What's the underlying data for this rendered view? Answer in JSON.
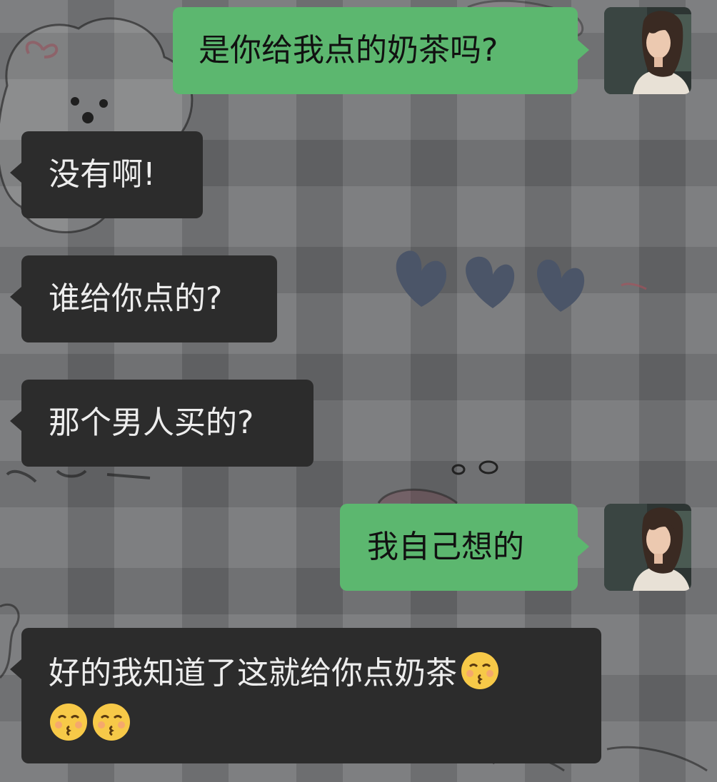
{
  "messages": [
    {
      "direction": "out",
      "text": "是你给我点的奶茶吗?",
      "sender": "me"
    },
    {
      "direction": "in",
      "text": "没有啊!"
    },
    {
      "direction": "in",
      "text": "谁给你点的?"
    },
    {
      "direction": "in",
      "text": "那个男人买的?"
    },
    {
      "direction": "out",
      "text": "我自己想的",
      "sender": "me"
    },
    {
      "direction": "in",
      "line1": "好的我知道了这就给你点奶茶",
      "emoji_icon": "kissing-face-with-smiling-eyes-icon"
    }
  ],
  "colors": {
    "outgoing_bubble": "#5cb76f",
    "incoming_bubble": "#2c2c2c",
    "background": "#6f7072"
  },
  "icons": {
    "avatar": "girl-portrait-avatar",
    "emoji": "kissing-face-with-smiling-eyes-icon"
  }
}
